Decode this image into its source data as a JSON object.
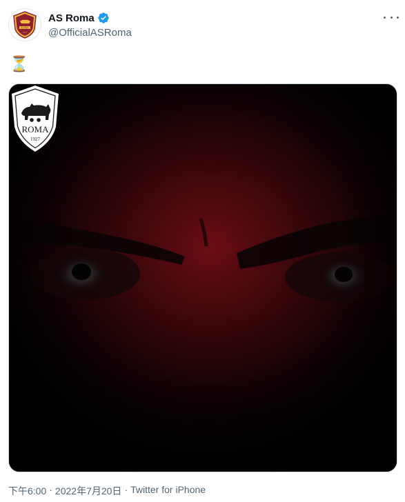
{
  "account": {
    "display_name": "AS Roma",
    "handle": "@OfficialASRoma",
    "verified": true,
    "avatar_icon": "as-roma-crest-icon"
  },
  "tweet": {
    "text": "⏳"
  },
  "media": {
    "crest_label": "ROMA",
    "crest_year": "1927",
    "accent_color": "#6a0d14"
  },
  "meta": {
    "time": "下午6:00",
    "separator1": "·",
    "date": "2022年7月20日",
    "separator2": "·",
    "source": "Twitter for iPhone"
  },
  "colors": {
    "text_primary": "#0f1419",
    "text_secondary": "#536471",
    "verified": "#1d9bf0",
    "roma_gold": "#f0bc42",
    "roma_red": "#8e1f2f"
  }
}
